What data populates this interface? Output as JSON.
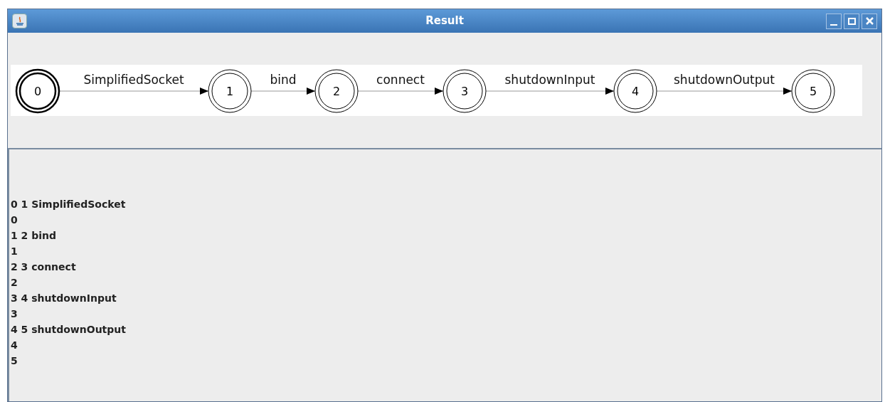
{
  "window": {
    "title": "Result"
  },
  "diagram": {
    "states": [
      {
        "label": "0",
        "initial": true
      },
      {
        "label": "1",
        "initial": false
      },
      {
        "label": "2",
        "initial": false
      },
      {
        "label": "3",
        "initial": false
      },
      {
        "label": "4",
        "initial": false
      },
      {
        "label": "5",
        "initial": false
      }
    ],
    "transitions": [
      {
        "label": "SimplifiedSocket"
      },
      {
        "label": "bind"
      },
      {
        "label": "connect"
      },
      {
        "label": "shutdownInput"
      },
      {
        "label": "shutdownOutput"
      }
    ]
  },
  "output_lines": [
    "0 1 SimplifiedSocket",
    "0",
    "1 2 bind",
    "1",
    "2 3 connect",
    "2",
    "3 4 shutdownInput",
    "3",
    "4 5 shutdownOutput",
    "4",
    "5"
  ]
}
